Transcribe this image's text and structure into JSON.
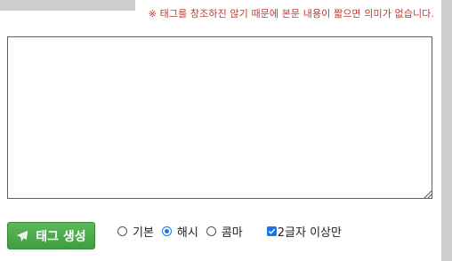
{
  "notice": "※ 태그를 창조하진 않기 때문에 본문 내용이 짧으면 의미가 없습니다.",
  "textarea": {
    "value": ""
  },
  "generate_button": {
    "label": "태그 생성",
    "icon": "paper-plane-icon"
  },
  "format_options": [
    {
      "label": "기본",
      "selected": false
    },
    {
      "label": "해시",
      "selected": true
    },
    {
      "label": "콤마",
      "selected": false
    }
  ],
  "min_length_checkbox": {
    "label": "2글자 이상만",
    "checked": true
  },
  "colors": {
    "notice": "#c0392b",
    "button": "#4cae4c",
    "accent": "#1a73e8"
  }
}
